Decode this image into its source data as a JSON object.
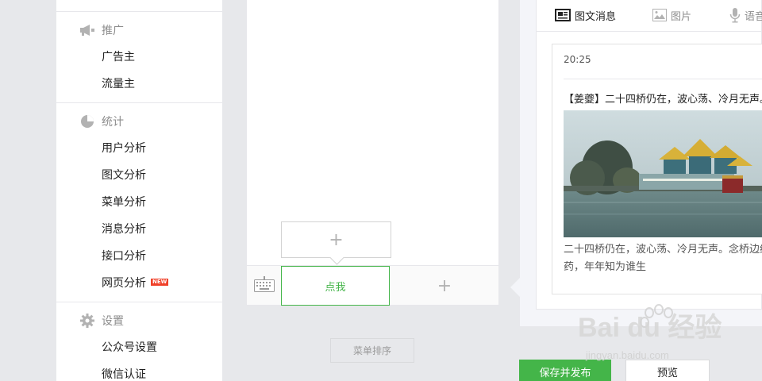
{
  "sidebar": {
    "sections": [
      {
        "title": "推广",
        "icon": "megaphone-icon",
        "items": [
          "广告主",
          "流量主"
        ]
      },
      {
        "title": "统计",
        "icon": "pie-chart-icon",
        "items": [
          "用户分析",
          "图文分析",
          "菜单分析",
          "消息分析",
          "接口分析",
          "网页分析"
        ]
      },
      {
        "title": "设置",
        "icon": "gear-icon",
        "items": [
          "公众号设置",
          "微信认证"
        ]
      }
    ],
    "new_badge": "NEW"
  },
  "phone_preview": {
    "menu_active_label": "点我",
    "add_submenu_symbol": "+",
    "add_menu_symbol": "+",
    "sort_button": "菜单排序"
  },
  "editor": {
    "tabs": [
      {
        "label": "图文消息",
        "icon": "news-icon"
      },
      {
        "label": "图片",
        "icon": "image-icon"
      },
      {
        "label": "语音",
        "icon": "microphone-icon"
      }
    ],
    "message": {
      "time": "20:25",
      "title": "【姜夔】二十四桥仍在，波心荡、冷月无声。",
      "description_line1": "二十四桥仍在，波心荡、冷月无声。念桥边红",
      "description_line2": "药，年年知为谁生"
    }
  },
  "footer": {
    "save_publish": "保存并发布",
    "preview": "预览"
  },
  "watermark": {
    "brand": "Bai du 经验",
    "url": "jingyan.baidu.com"
  },
  "colors": {
    "accent_green": "#44b549",
    "new_badge_red": "#f0412a"
  }
}
